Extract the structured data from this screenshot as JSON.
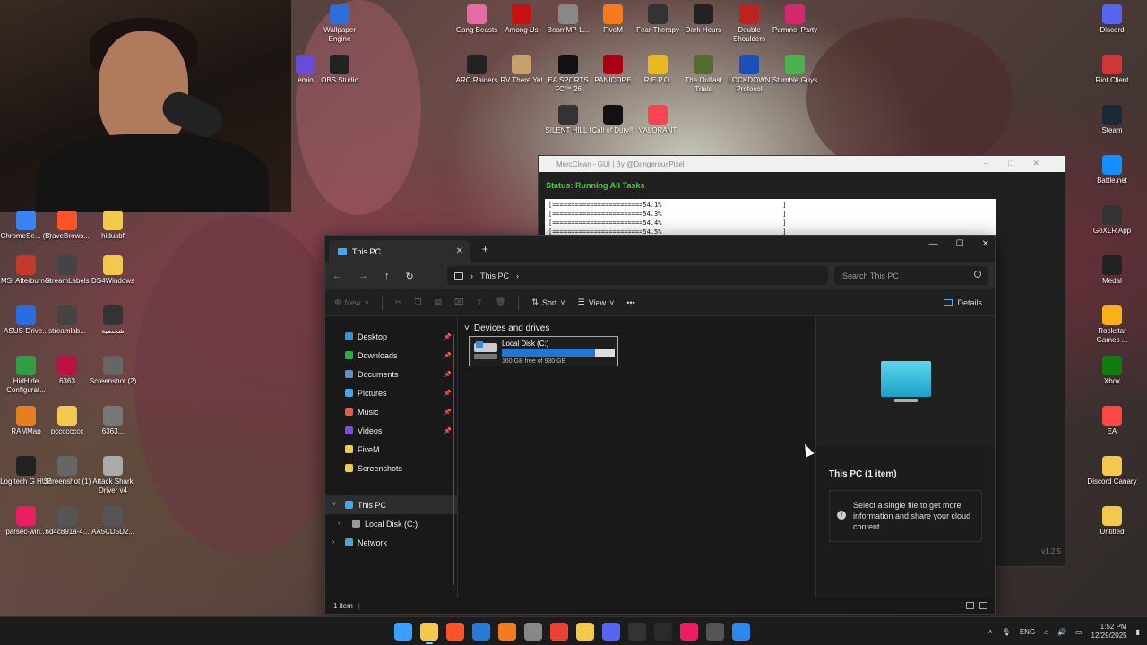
{
  "desktop": {
    "left_icons": [
      {
        "label": "ChromeSe... (1)",
        "color": "#3b82f6"
      },
      {
        "label": "BraveBrows...",
        "color": "#fb542b"
      },
      {
        "label": "hidusbf",
        "color": "#f2c94c"
      },
      {
        "label": "MSI Afterburner",
        "color": "#c0392b"
      },
      {
        "label": "StreamLabels",
        "color": "#444"
      },
      {
        "label": "DS4Windows",
        "color": "#f2c94c"
      },
      {
        "label": "ASUS-Drive...",
        "color": "#2d6cdf"
      },
      {
        "label": "streamlab...",
        "color": "#444"
      },
      {
        "label": "شخصية",
        "color": "#333"
      },
      {
        "label": "HidHide Configurat...",
        "color": "#2f9e44"
      },
      {
        "label": "6363",
        "color": "#b14"
      },
      {
        "label": "Screenshot (2)",
        "color": "#666"
      },
      {
        "label": "RAMMap",
        "color": "#e67e22"
      },
      {
        "label": "pcccccccc",
        "color": "#f2c94c"
      },
      {
        "label": "6363...",
        "color": "#777"
      },
      {
        "label": "Logitech G HUB",
        "color": "#222"
      },
      {
        "label": "Screenshot (1)",
        "color": "#666"
      },
      {
        "label": "Attack Shark Driver v4",
        "color": "#aaa"
      },
      {
        "label": "parsec-win...",
        "color": "#e91e63"
      },
      {
        "label": "6d4c891a-4...",
        "color": "#555"
      },
      {
        "label": "AA5CD5D2...",
        "color": "#555"
      }
    ],
    "top_icons": [
      {
        "label": "Wallpaper Engine",
        "color": "#2c6fd6"
      },
      {
        "label": "OBS Studio",
        "color": "#222"
      },
      {
        "label": "emio",
        "color": "#6a4bd6"
      },
      {
        "label": "Gang Beasts",
        "color": "#e46ba4"
      },
      {
        "label": "Among Us",
        "color": "#c51111"
      },
      {
        "label": "BeamMP-L...",
        "color": "#888"
      },
      {
        "label": "FiveM",
        "color": "#f47c20"
      },
      {
        "label": "Fear Therapy",
        "color": "#333"
      },
      {
        "label": "Dark Hours",
        "color": "#222"
      },
      {
        "label": "Double Shoulders",
        "color": "#b22"
      },
      {
        "label": "Pummel Party",
        "color": "#d4276e"
      },
      {
        "label": "ARC Raiders",
        "color": "#222"
      },
      {
        "label": "RV There Yet",
        "color": "#c8a06b"
      },
      {
        "label": "EA SPORTS FC™ 26",
        "color": "#111"
      },
      {
        "label": "PANICORE",
        "color": "#a01"
      },
      {
        "label": "R.E.P.O.",
        "color": "#e8b923"
      },
      {
        "label": "The Outlast Trials",
        "color": "#556b2f"
      },
      {
        "label": "LOCKDOWN Protocol",
        "color": "#1e4fb8"
      },
      {
        "label": "Stumble Guys",
        "color": "#4cb050"
      },
      {
        "label": "SILENT HILL f",
        "color": "#333"
      },
      {
        "label": "Call of Duty®",
        "color": "#111"
      },
      {
        "label": "VALORANT",
        "color": "#fa4454"
      }
    ],
    "right_icons": [
      {
        "label": "Discord",
        "color": "#5865f2"
      },
      {
        "label": "Riot Client",
        "color": "#d13639"
      },
      {
        "label": "Steam",
        "color": "#1b2838"
      },
      {
        "label": "Battle.net",
        "color": "#148eff"
      },
      {
        "label": "GoXLR App",
        "color": "#333"
      },
      {
        "label": "Medal",
        "color": "#222"
      },
      {
        "label": "Rockstar Games ...",
        "color": "#fcaf17"
      },
      {
        "label": "Xbox",
        "color": "#107c10"
      },
      {
        "label": "EA",
        "color": "#ff4747"
      },
      {
        "label": "Discord Canary",
        "color": "#f2c94c"
      },
      {
        "label": "Untitled",
        "color": "#f2c94c"
      }
    ]
  },
  "mercclean": {
    "title": "MercClean - GUI | By @DangerousPixel",
    "status": "Status: Running All Tasks",
    "console_lines": [
      "[========================54.1%                                ]",
      "[========================54.3%                                ]",
      "[========================54.4%                                ]",
      "[========================54.5%                                ]"
    ],
    "version": "v1.2.5"
  },
  "explorer": {
    "tab_title": "This PC",
    "breadcrumb": "This PC",
    "search_placeholder": "Search This PC",
    "toolbar": {
      "new": "New",
      "sort": "Sort",
      "view": "View",
      "more": "•••",
      "details": "Details"
    },
    "sidebar": {
      "quick": [
        {
          "label": "Desktop",
          "color": "#3b8be8"
        },
        {
          "label": "Downloads",
          "color": "#2fa84f"
        },
        {
          "label": "Documents",
          "color": "#5b8fd6"
        },
        {
          "label": "Pictures",
          "color": "#49a3e8"
        },
        {
          "label": "Music",
          "color": "#e0604a"
        },
        {
          "label": "Videos",
          "color": "#7a4fd6"
        },
        {
          "label": "FiveM",
          "color": "#f2c94c"
        },
        {
          "label": "Screenshots",
          "color": "#f2c94c"
        }
      ],
      "this_pc": "This PC",
      "local_disk": "Local Disk (C:)",
      "network": "Network"
    },
    "group_header": "Devices and drives",
    "drive": {
      "name": "Local Disk (C:)",
      "free_text": "160 GB free of 930 GB",
      "used_fraction": 0.828
    },
    "details": {
      "title": "This PC (1 item)",
      "info": "Select a single file to get more information and share your cloud content."
    },
    "status_bar": "1 item"
  },
  "taskbar": {
    "apps": [
      {
        "name": "start",
        "color": "#3aa0ff"
      },
      {
        "name": "file-explorer",
        "color": "#f2c94c"
      },
      {
        "name": "brave",
        "color": "#fb542b"
      },
      {
        "name": "store",
        "color": "#2b79d6"
      },
      {
        "name": "fivem",
        "color": "#f47c20"
      },
      {
        "name": "steam",
        "color": "#888"
      },
      {
        "name": "chrome",
        "color": "#ea4335"
      },
      {
        "name": "discord-canary",
        "color": "#f2c94c"
      },
      {
        "name": "discord",
        "color": "#5865f2"
      },
      {
        "name": "medal",
        "color": "#333"
      },
      {
        "name": "goxlr",
        "color": "#2a2a2a"
      },
      {
        "name": "parsec",
        "color": "#e91e63"
      },
      {
        "name": "task-view",
        "color": "#555"
      },
      {
        "name": "mercclean",
        "color": "#2b8ae8"
      }
    ],
    "tray": {
      "lang": "ENG",
      "time": "1:52 PM",
      "date": "12/29/2025"
    }
  }
}
